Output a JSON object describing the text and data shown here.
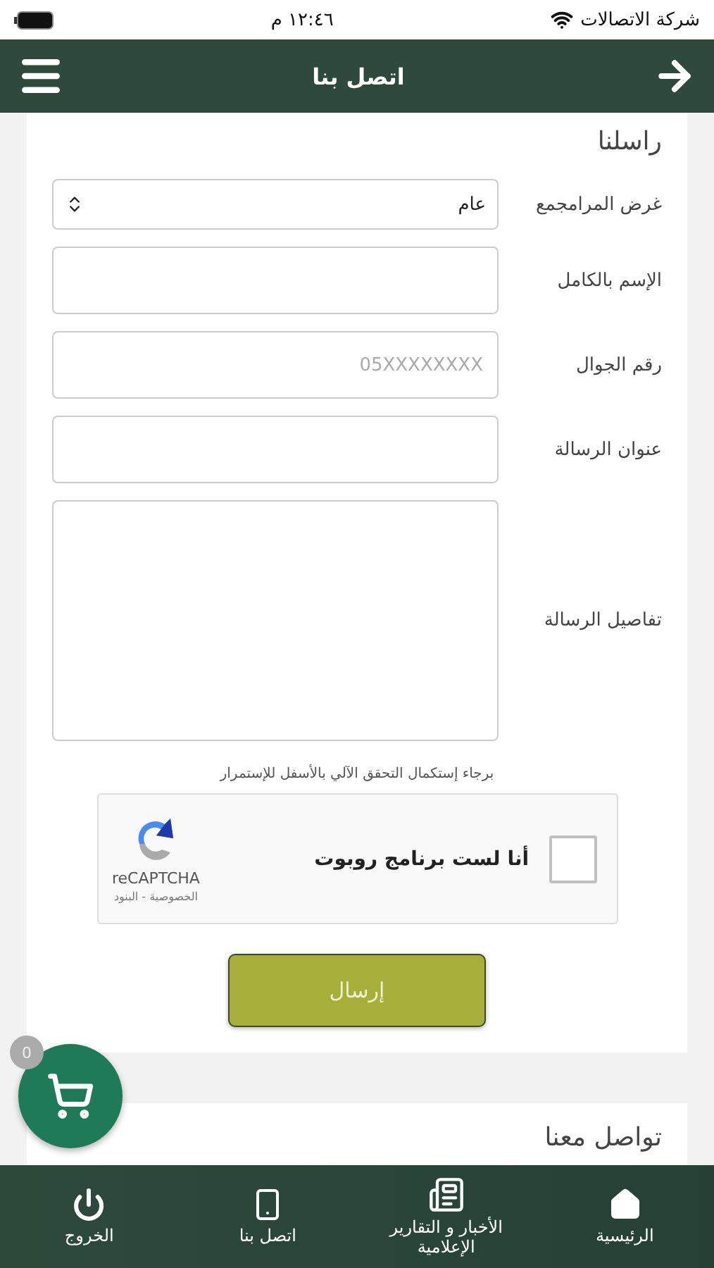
{
  "status_bar": {
    "carrier": "شركة الاتصالات",
    "time": "١٢:٤٦ م"
  },
  "header": {
    "title": "اتصل بنا"
  },
  "form": {
    "title": "راسلنا",
    "fields": [
      {
        "kind": "select",
        "label": "غرض المرامجمع",
        "value": "عام"
      },
      {
        "kind": "text",
        "label": "الإسم بالكامل"
      },
      {
        "kind": "text",
        "label": "رقم الجوال",
        "placeholder": "05XXXXXXXX"
      },
      {
        "kind": "text",
        "label": "عنوان الرسالة"
      },
      {
        "kind": "textarea",
        "label": "تفاصيل الرسالة"
      }
    ],
    "note": "برجاء إستكمال التحقق الآلي بالأسفل للإستمرار",
    "captcha": {
      "label": "أنا لست برنامج روبوت",
      "checked": false,
      "brand": "reCAPTCHA",
      "links": "الخصوصية - البنود"
    },
    "submit": "إرسال"
  },
  "next_section": {
    "title": "تواصل معنا"
  },
  "cart": {
    "count": "0"
  },
  "bottom_nav": [
    {
      "kind": "home",
      "label": "الرئيسية"
    },
    {
      "kind": "news",
      "label": "الأخبار و التقارير الإعلامية"
    },
    {
      "kind": "phone",
      "label": "اتصل بنا"
    },
    {
      "kind": "power",
      "label": "الخروج"
    }
  ]
}
